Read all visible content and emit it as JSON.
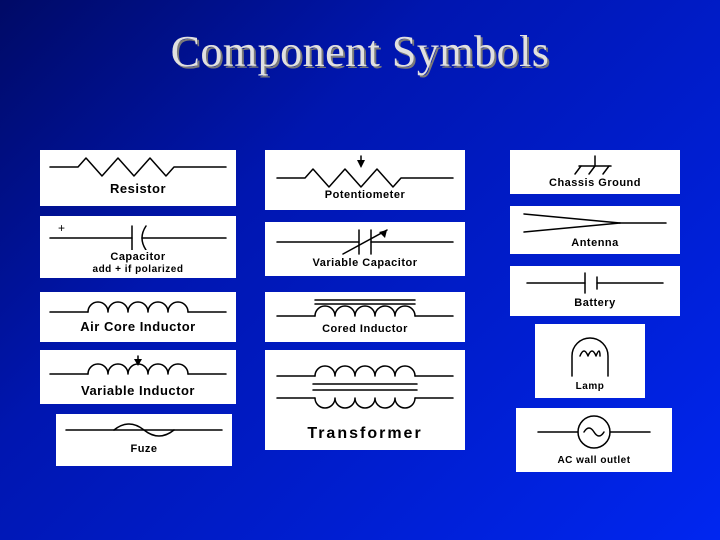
{
  "title": "Component Symbols",
  "cards": {
    "resistor": "Resistor",
    "potentiometer": "Potentiometer",
    "chassis_ground": "Chassis Ground",
    "capacitor": "Capacitor",
    "capacitor_hint": "add + if polarized",
    "variable_capacitor": "Variable Capacitor",
    "antenna": "Antenna",
    "air_core_inductor": "Air Core Inductor",
    "cored_inductor": "Cored Inductor",
    "battery": "Battery",
    "variable_inductor": "Variable Inductor",
    "transformer": "Transformer",
    "lamp": "Lamp",
    "fuze": "Fuze",
    "ac_outlet": "AC  wall outlet"
  }
}
